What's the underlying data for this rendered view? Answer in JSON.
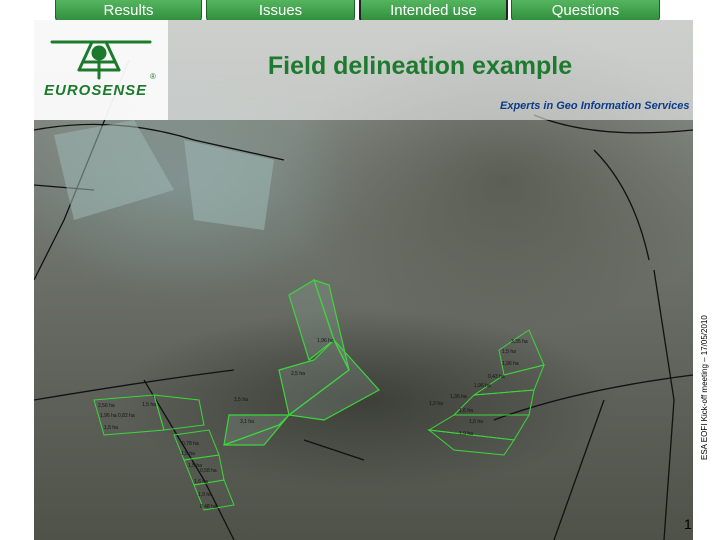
{
  "tabs": [
    {
      "label": "Results",
      "active": false
    },
    {
      "label": "Issues",
      "active": false
    },
    {
      "label": "Intended use",
      "active": true
    },
    {
      "label": "Questions",
      "active": false
    }
  ],
  "header": {
    "title": "Field delineation example",
    "logo_text": "EUROSENSE",
    "tagline": "Experts in Geo Information Services"
  },
  "footer": {
    "side_note": "ESA EOFI Kick-off meeting – 17/05/2010",
    "page_number": "1"
  },
  "field_labels": [
    "1,96 ha",
    "2,5 ha",
    "1,5 ha",
    "3,1 ha",
    "2,56 ha",
    "1,5 ha",
    "1,96 ha",
    "0,82 ha",
    "1,5 ha",
    "0,78 ha",
    "3,35 ha",
    "1,5 ha",
    "1,96 ha",
    "0,43 ha",
    "1,96 ha",
    "1,36 ha",
    "1,2 ha",
    "1,6 ha",
    "1,6 ha",
    "1,9 ha",
    "1,5 ha",
    "1,5 ha",
    "0,58 ha",
    "1,6 ha",
    "1,9 ha",
    "0,48 ha"
  ],
  "colors": {
    "tab_fill": "#3a9b45",
    "title_green": "#1d7a2e",
    "tagline_blue": "#0b3a8c",
    "field_outline": "#3cd63c"
  }
}
